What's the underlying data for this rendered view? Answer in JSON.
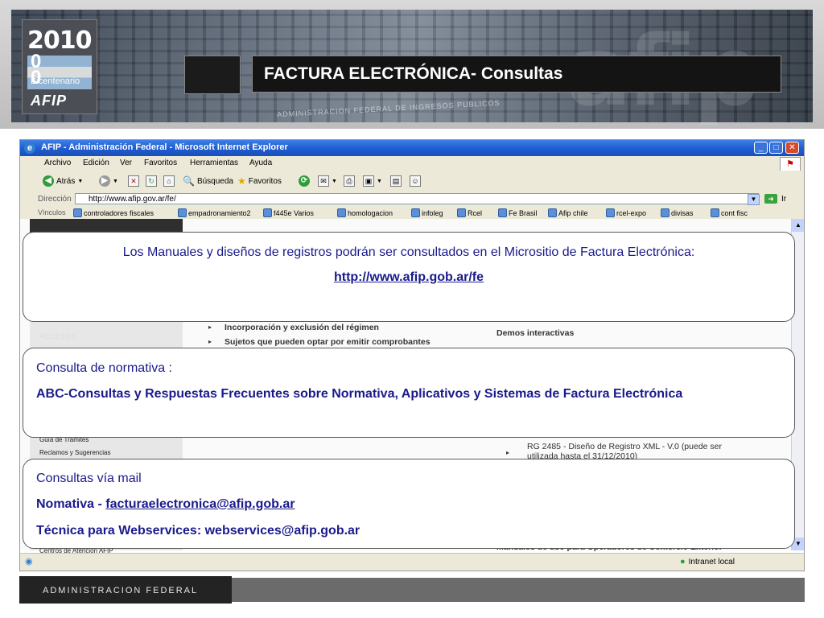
{
  "header": {
    "logo": {
      "year": "2010",
      "zero": "0\n0",
      "bicentenario": "Bicentenario",
      "afip": "AFIP"
    },
    "background_brand": "afip",
    "background_caption": "ADMINISTRACION FEDERAL DE INGRESOS PUBLICOS",
    "title": "FACTURA ELECTRÓNICA- Consultas"
  },
  "browser": {
    "window_title": "AFIP - Administración Federal - Microsoft Internet Explorer",
    "menu": [
      "Archivo",
      "Edición",
      "Ver",
      "Favoritos",
      "Herramientas",
      "Ayuda"
    ],
    "toolbar": {
      "back": "Atrás",
      "search": "Búsqueda",
      "favorites": "Favoritos"
    },
    "address_label": "Dirección",
    "address_value": "http://www.afip.gov.ar/fe/",
    "go_label": "Ir",
    "links_label": "Vínculos",
    "links": [
      "controladores fiscales",
      "empadronamiento2",
      "f445e Varios",
      "homologacion",
      "infoleg",
      "Rcel",
      "Fe Brasil",
      "Afip chile",
      "rcel-expo",
      "divisas",
      "cont fisc"
    ],
    "status_zone": "Intranet local"
  },
  "page_behind": {
    "left_menu": [
      "ACCESOS",
      "Guía de Trámites",
      "Reclamos y Sugerencias",
      "Centros de Atención AFIP"
    ],
    "items": [
      "Incorporación y exclusión del régimen",
      "Sujetos que pueden optar por emitir comprobantes",
      "Demos interactivas",
      "RG 2485 - Diseño de Registro XML - V.0 (puede ser",
      "utilizada hasta el 31/12/2010)",
      "Manuales de uso para Operadores de Comercio Exterior"
    ]
  },
  "boxes": {
    "manuales": {
      "text": "Los Manuales y diseños de registros podrán ser consultados en el Micrositio de Factura Electrónica:",
      "link": "http://www.afip.gob.ar/fe"
    },
    "normativa": {
      "label": "Consulta de normativa :",
      "text": "ABC-Consultas y Respuestas Frecuentes sobre Normativa, Aplicativos y Sistemas de Factura Electrónica"
    },
    "mail": {
      "label": "Consultas vía mail",
      "normativa_prefix": "Nomativa - ",
      "normativa_email": "facturaelectronica@afip.gob.ar",
      "tecnica_prefix": "Técnica para Webservices: ",
      "tecnica_email": "webservices@afip.gob.ar"
    }
  },
  "footer": {
    "text": "ADMINISTRACION FEDERAL"
  },
  "colors": {
    "text_blue": "#1a1a8c",
    "ie_blue": "#1f5ed3",
    "chrome": "#ece9d8"
  }
}
